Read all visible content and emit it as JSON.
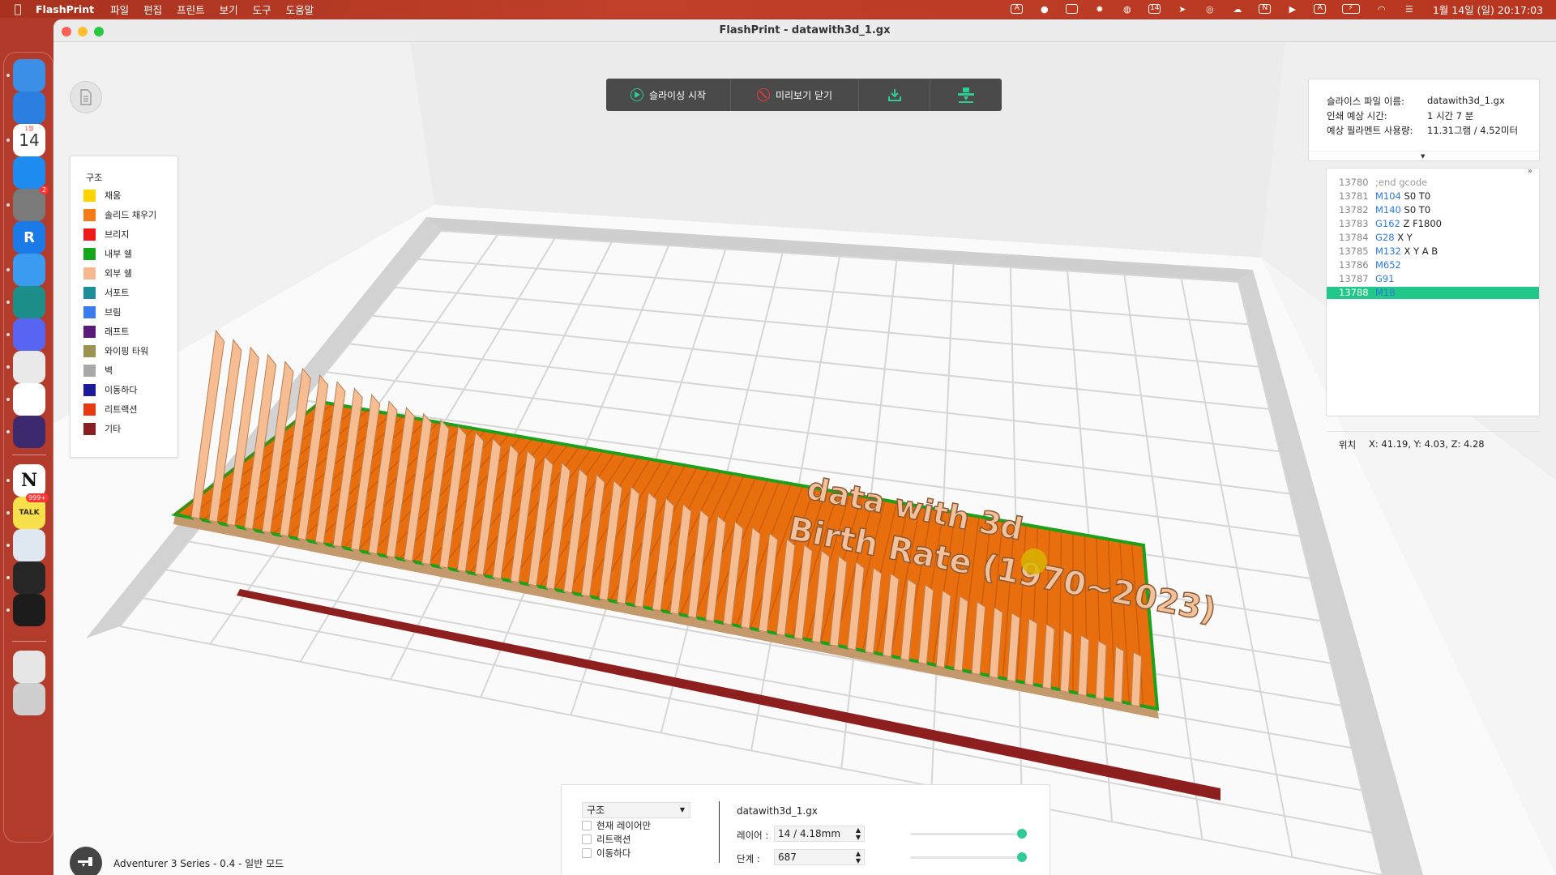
{
  "menubar": {
    "app_name": "FlashPrint",
    "menus": [
      "파일",
      "편집",
      "프린트",
      "보기",
      "도구",
      "도움말"
    ],
    "status_icons": [
      "adobe-icon",
      "cloud-sync-icon",
      "sidebar-icon",
      "brightness-icon",
      "globe-icon",
      "calendar-icon",
      "telegram-icon",
      "fingerprint-icon",
      "weather-icon",
      "notion-icon",
      "play-icon",
      "keyboard-input-icon",
      "battery-icon",
      "wifi-icon",
      "control-center-icon"
    ],
    "calendar_icon_text": "14",
    "notion_icon_text": "N",
    "input_icon_text": "A",
    "clock": "1월 14일 (일) 20:17:03"
  },
  "dock": {
    "apps": [
      {
        "name": "finder",
        "color": "#3b8fe6"
      },
      {
        "name": "safari",
        "color": "#2b7fe0"
      },
      {
        "name": "calendar",
        "color": "#ffffff",
        "text": "14",
        "month": "1월"
      },
      {
        "name": "app-store",
        "color": "#1e8cf0"
      },
      {
        "name": "system-settings",
        "color": "#7a7a7a",
        "badge": "2"
      },
      {
        "name": "raindrop",
        "color": "#1a7be8",
        "text": "R"
      },
      {
        "name": "mail",
        "color": "#3a9bf0"
      },
      {
        "name": "bird-app",
        "color": "#1d8f8a"
      },
      {
        "name": "discord",
        "color": "#5865f2"
      },
      {
        "name": "chrome",
        "color": "#e9e9e9"
      },
      {
        "name": "slack",
        "color": "#ffffff"
      },
      {
        "name": "obsidian",
        "color": "#3d2a6e"
      },
      {
        "name": "notion",
        "color": "#ffffff",
        "text": "N"
      },
      {
        "name": "kakaotalk",
        "color": "#f7e04b",
        "text": "TALK",
        "badge": "999+"
      },
      {
        "name": "preview",
        "color": "#dfe8f0"
      },
      {
        "name": "blender",
        "color": "#262626"
      },
      {
        "name": "flashprint",
        "color": "#1c1c1c"
      },
      {
        "name": "downloads",
        "color": "#e6e6e6"
      },
      {
        "name": "trash",
        "color": "#cfcfcf"
      }
    ]
  },
  "window": {
    "title": "FlashPrint - datawith3d_1.gx"
  },
  "toolbar": {
    "start_slicing": "슬라이싱 시작",
    "close_preview": "미리보기 닫기"
  },
  "legend": {
    "title": "구조",
    "items": [
      {
        "label": "채움",
        "color": "#ffd200"
      },
      {
        "label": "솔리드 채우기",
        "color": "#f57c14"
      },
      {
        "label": "브리지",
        "color": "#f01818"
      },
      {
        "label": "내부 쉘",
        "color": "#12a81a"
      },
      {
        "label": "외부 쉘",
        "color": "#f8b890"
      },
      {
        "label": "서포트",
        "color": "#1c8f9a"
      },
      {
        "label": "브림",
        "color": "#3a7cf0"
      },
      {
        "label": "래프트",
        "color": "#5a1a7a"
      },
      {
        "label": "와이핑 타워",
        "color": "#9a9450"
      },
      {
        "label": "벽",
        "color": "#a8a8a8"
      },
      {
        "label": "이동하다",
        "color": "#1c1a9a"
      },
      {
        "label": "리트랙션",
        "color": "#e83a12"
      },
      {
        "label": "기타",
        "color": "#8a2020"
      }
    ]
  },
  "info": {
    "rows": [
      {
        "key": "슬라이스 파일 이름:",
        "value": "datawith3d_1.gx"
      },
      {
        "key": "인쇄 예상 시간:",
        "value": "1 시간 7 분"
      },
      {
        "key": "예상 필라멘트 사용량:",
        "value": "11.31그램 / 4.52미터"
      }
    ]
  },
  "gcode": {
    "lines": [
      {
        "num": "13780",
        "cmd": "",
        "args": ";end gcode"
      },
      {
        "num": "13781",
        "cmd": "M104",
        "args": "S0 T0"
      },
      {
        "num": "13782",
        "cmd": "M140",
        "args": "S0 T0"
      },
      {
        "num": "13783",
        "cmd": "G162",
        "args": "Z F1800"
      },
      {
        "num": "13784",
        "cmd": "G28",
        "args": "X Y"
      },
      {
        "num": "13785",
        "cmd": "M132",
        "args": "X Y A B"
      },
      {
        "num": "13786",
        "cmd": "M652",
        "args": ""
      },
      {
        "num": "13787",
        "cmd": "G91",
        "args": ""
      },
      {
        "num": "13788",
        "cmd": "M18",
        "args": "",
        "active": true
      }
    ],
    "expand_label": "»",
    "position_label": "위치",
    "position_value": "X: 41.19, Y: 4.03, Z: 4.28"
  },
  "preview": {
    "model_text_line1": "data with 3d",
    "model_text_line2": "Birth Rate (1970~2023)",
    "bars_shown": 54
  },
  "bottom": {
    "mode_value": "구조",
    "checkboxes": [
      "현재 레이어만",
      "리트랙션",
      "이동하다"
    ],
    "file_name": "datawith3d_1.gx",
    "layer_label": "레이어 :",
    "layer_value": "14 / 4.18mm",
    "step_label": "단계 :",
    "step_value": "687",
    "layer_slider": 1.0,
    "step_slider": 1.0
  },
  "status": {
    "printer": "Adventurer 3 Series - 0.4 - 일반 모드"
  }
}
